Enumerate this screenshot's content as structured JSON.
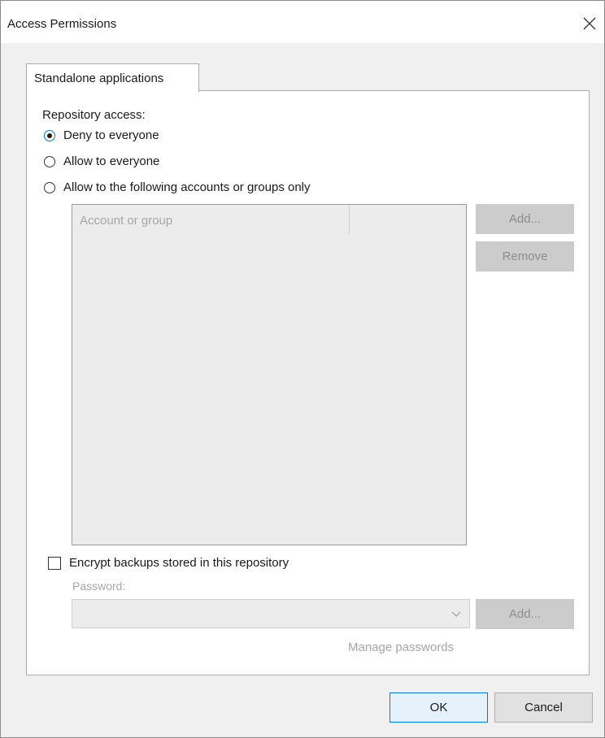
{
  "window": {
    "title": "Access Permissions"
  },
  "tabs": [
    {
      "label": "Standalone applications"
    }
  ],
  "repository_access": {
    "label": "Repository access:",
    "options": [
      {
        "label": "Deny to everyone",
        "checked": true
      },
      {
        "label": "Allow to everyone",
        "checked": false
      },
      {
        "label": "Allow to the following accounts or groups only",
        "checked": false
      }
    ]
  },
  "accounts_list": {
    "columns": [
      "Account or group",
      ""
    ],
    "rows": []
  },
  "list_buttons": {
    "add": "Add...",
    "remove": "Remove"
  },
  "encryption": {
    "checkbox_label": "Encrypt backups stored in this repository",
    "checked": false,
    "password_label": "Password:",
    "password_value": "",
    "add_button": "Add...",
    "manage_link": "Manage passwords"
  },
  "footer": {
    "ok": "OK",
    "cancel": "Cancel"
  },
  "colors": {
    "accent": "#0078d7",
    "disabled_text": "#a6a6a6",
    "disabled_button": "#cccccc"
  },
  "icons": {
    "close": "close-icon",
    "dropdown": "chevron-down-icon"
  }
}
